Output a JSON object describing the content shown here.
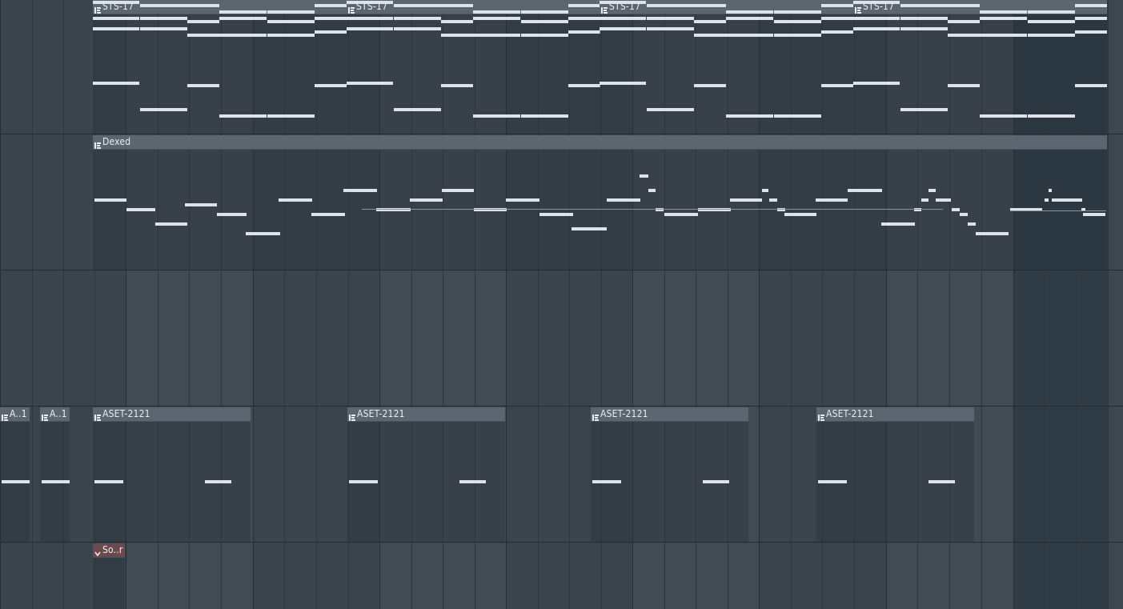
{
  "playlist": {
    "clips": [
      {
        "name": "STS-17",
        "kind": "pattern"
      },
      {
        "name": "Dexed",
        "kind": "pattern"
      },
      {
        "name": "A..1",
        "kind": "pattern"
      },
      {
        "name": "ASET-2121",
        "kind": "pattern"
      },
      {
        "name": "So..r",
        "kind": "audio"
      }
    ]
  },
  "colors": {
    "background": "#3a444d",
    "clip_header": "#5b6670",
    "note": "#dde3e8",
    "audio_header": "#6b4a4f"
  },
  "icons": {
    "pattern_clip": "pattern-clip-icon",
    "audio_clip": "chevron-down-icon"
  }
}
